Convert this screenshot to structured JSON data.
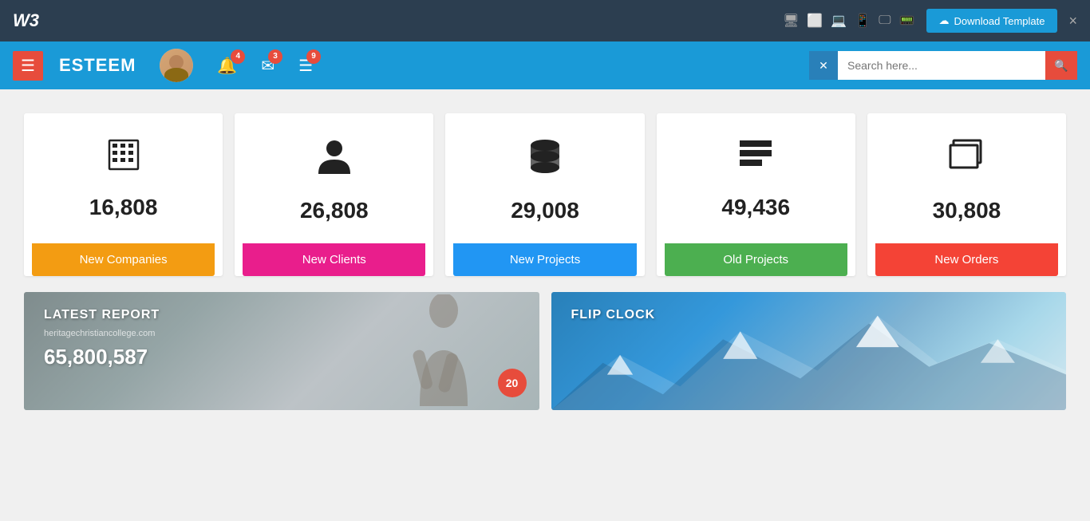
{
  "topbar": {
    "logo": "W3",
    "download_label": "Download Template",
    "close_label": "×"
  },
  "navbar": {
    "brand": "ESTEEM",
    "notifications_count": "4",
    "messages_count": "3",
    "tasks_count": "9",
    "search_placeholder": "Search here...",
    "x_icon": "✕"
  },
  "stats": [
    {
      "icon": "🏢",
      "number": "16,808",
      "label": "New Companies",
      "color_class": "label-orange"
    },
    {
      "icon": "👤",
      "number": "26,808",
      "label": "New Clients",
      "color_class": "label-pink"
    },
    {
      "icon": "🗄",
      "number": "29,008",
      "label": "New Projects",
      "color_class": "label-blue"
    },
    {
      "icon": "☰",
      "number": "49,436",
      "label": "Old Projects",
      "color_class": "label-green"
    },
    {
      "icon": "❐",
      "number": "30,808",
      "label": "New Orders",
      "color_class": "label-red"
    }
  ],
  "panels": {
    "left": {
      "title": "LATEST REPORT",
      "subtitle": "heritagechristiancollege.com",
      "number": "65,800,587",
      "badge": "20"
    },
    "right": {
      "title": "FLIP CLOCK"
    }
  }
}
